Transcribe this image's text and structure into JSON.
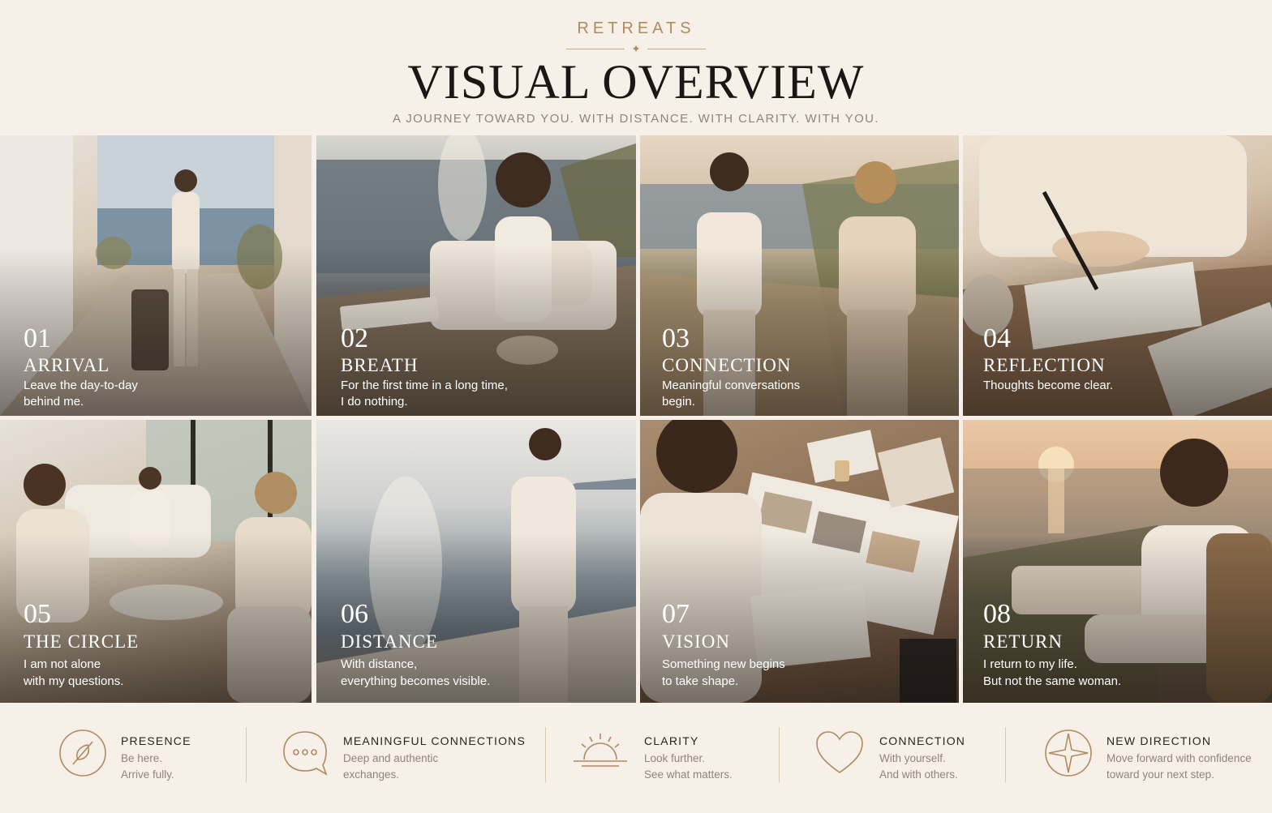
{
  "header": {
    "eyebrow": "RETREATS",
    "title": "VISUAL OVERVIEW",
    "subtitle": "A JOURNEY TOWARD YOU. WITH DISTANCE. WITH CLARITY. WITH YOU."
  },
  "tiles": [
    {
      "number": "01",
      "name": "ARRIVAL",
      "line1": "Leave the day-to-day",
      "line2": "behind me."
    },
    {
      "number": "02",
      "name": "BREATH",
      "line1": "For the first time in a long time,",
      "line2": "I do nothing."
    },
    {
      "number": "03",
      "name": "CONNECTION",
      "line1": "Meaningful conversations",
      "line2": "begin."
    },
    {
      "number": "04",
      "name": "REFLECTION",
      "line1": "Thoughts become clear.",
      "line2": ""
    },
    {
      "number": "05",
      "name": "THE CIRCLE",
      "line1": "I am not alone",
      "line2": "with my questions."
    },
    {
      "number": "06",
      "name": "DISTANCE",
      "line1": "With distance,",
      "line2": "everything becomes visible."
    },
    {
      "number": "07",
      "name": "VISION",
      "line1": "Something new begins",
      "line2": "to take shape."
    },
    {
      "number": "08",
      "name": "RETURN",
      "line1": "I return to my life.",
      "line2": "But not the same woman."
    }
  ],
  "features": [
    {
      "icon": "leaf-icon",
      "title": "PRESENCE",
      "line1": "Be here.",
      "line2": "Arrive fully."
    },
    {
      "icon": "speech-bubble-icon",
      "title": "MEANINGFUL CONNECTIONS",
      "line1": "Deep and authentic",
      "line2": "exchanges."
    },
    {
      "icon": "sunrise-icon",
      "title": "CLARITY",
      "line1": "Look further.",
      "line2": "See what matters."
    },
    {
      "icon": "heart-icon",
      "title": "CONNECTION",
      "line1": "With yourself.",
      "line2": "And with others."
    },
    {
      "icon": "compass-star-icon",
      "title": "NEW DIRECTION",
      "line1": "Move forward with confidence",
      "line2": "toward your next step."
    }
  ],
  "colors": {
    "accent": "#b08a5e",
    "background": "#f6f0e9",
    "ink": "#1c1714",
    "muted": "#8e857c"
  }
}
